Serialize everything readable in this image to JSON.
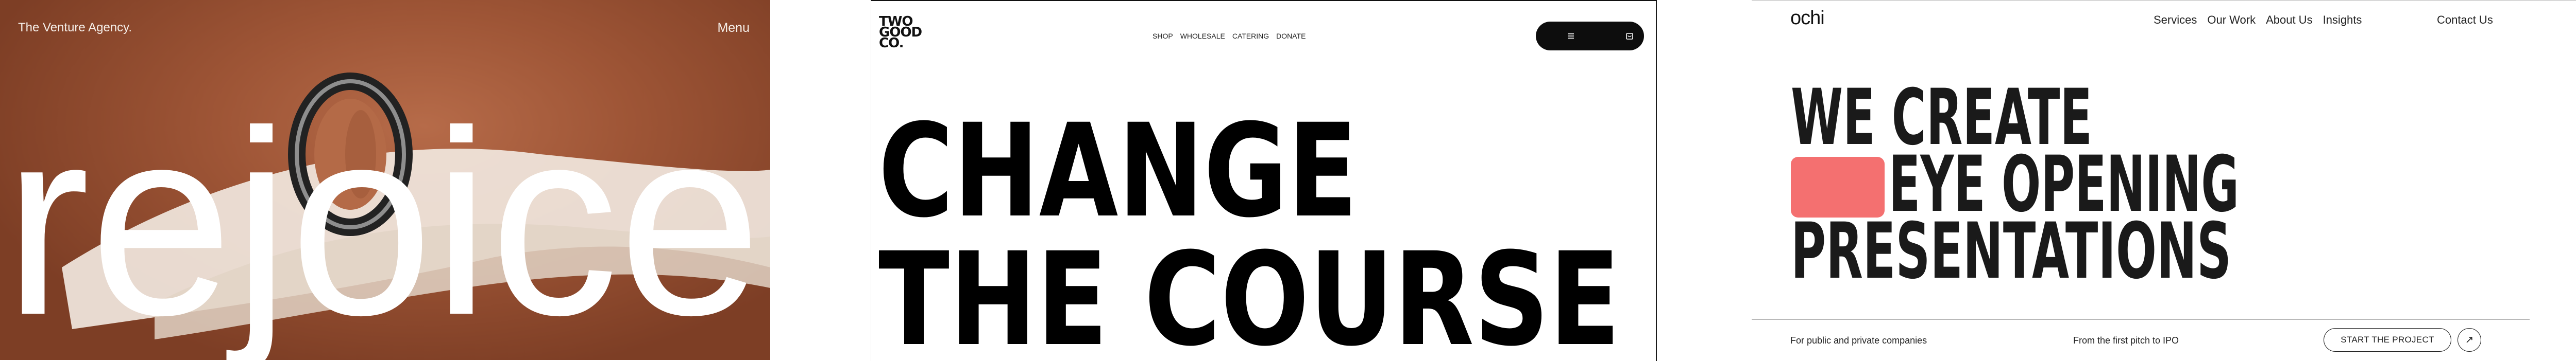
{
  "venture": {
    "brand": "The Venture Agency.",
    "menu": "Menu",
    "hero_word": "rejoice"
  },
  "twogood": {
    "logo_lines": [
      "TWO",
      "GOOD",
      "CO."
    ],
    "nav": [
      "SHOP",
      "WHOLESALE",
      "CATERING",
      "DONATE"
    ],
    "headline_lines": [
      "CHANGE",
      "THE COURSE"
    ]
  },
  "ochi": {
    "logo": "ochi",
    "nav": [
      "Services",
      "Our Work",
      "About Us",
      "Insights"
    ],
    "contact": "Contact Us",
    "headline_lines": [
      "WE CREATE",
      "EYE OPENING",
      "PRESENTATIONS"
    ],
    "accent_color": "#f47070",
    "footer_left": "For public and private companies",
    "footer_mid": "From the first pitch to IPO",
    "cta": "START THE PROJECT",
    "cta_icon": "arrow-up-right-icon"
  }
}
